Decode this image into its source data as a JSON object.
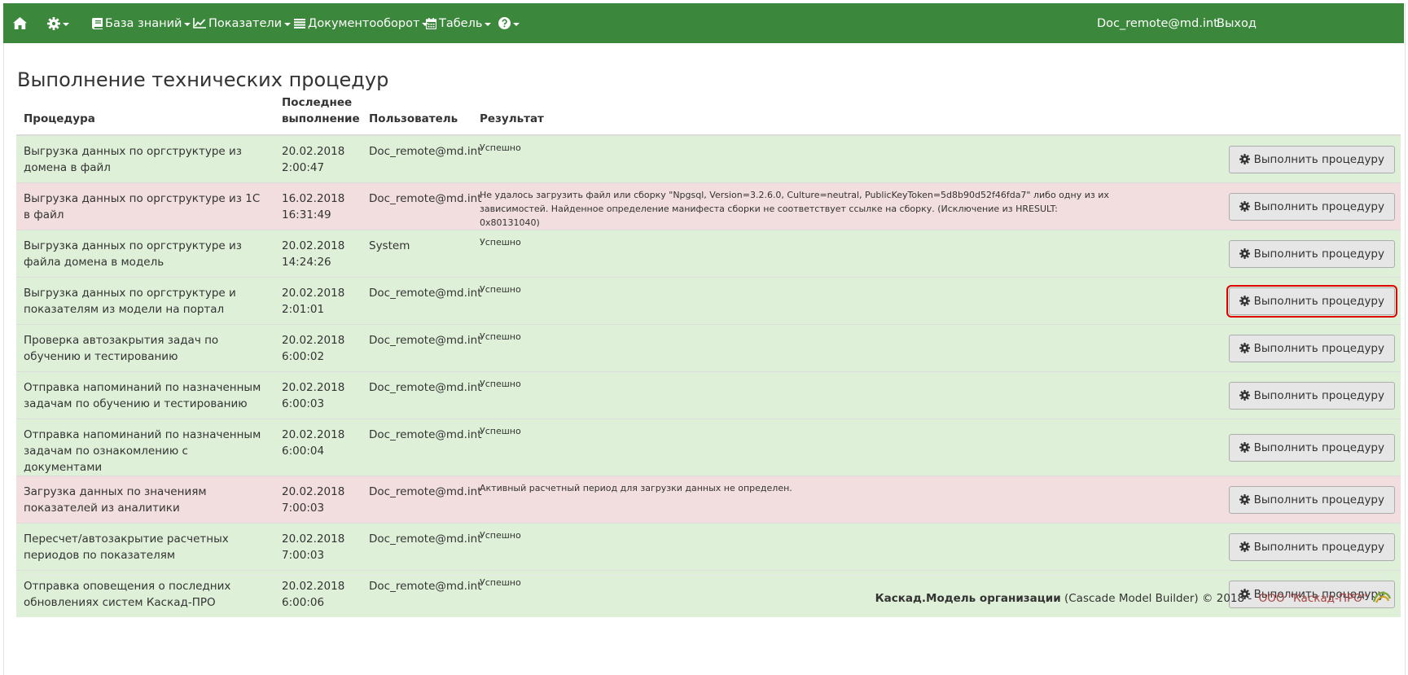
{
  "colors": {
    "navbar": "#3b873b",
    "success_row": "#dff0d8",
    "error_row": "#f2dede",
    "button_bg": "#e6e6e6",
    "highlight": "#e00000",
    "company_link": "#a94442"
  },
  "navbar": {
    "home_icon": "home-icon",
    "settings_icon": "gear-icon",
    "knowledge_base": "База знаний",
    "indicators": "Показатели",
    "document_flow": "Документооборот",
    "timesheet": "Табель",
    "help_icon": "question-circle-icon",
    "user": "Doc_remote@md.int",
    "logout": "Выход"
  },
  "page": {
    "title": "Выполнение технических процедур"
  },
  "table": {
    "headers": {
      "procedure": "Процедура",
      "last_run_line1": "Последнее",
      "last_run_line2": "выполнение",
      "user": "Пользователь",
      "result": "Результат"
    },
    "button_label": "Выполнить процедуру",
    "rows": [
      {
        "status": "success",
        "procedure": "Выгрузка данных по оргструктуре из домена в файл",
        "date": "20.02.2018",
        "time": "2:00:47",
        "user": "Doc_remote@md.int",
        "result": "Успешно"
      },
      {
        "status": "error",
        "procedure": "Выгрузка данных по оргструктуре из 1С в файл",
        "date": "16.02.2018",
        "time": "16:31:49",
        "user": "Doc_remote@md.int",
        "result": "Не удалось загрузить файл или сборку \"Npgsql, Version=3.2.6.0, Culture=neutral, PublicKeyToken=5d8b90d52f46fda7\" либо одну из их зависимостей. Найденное определение манифеста сборки не соответствует ссылке на сборку. (Исключение из HRESULT: 0x80131040)"
      },
      {
        "status": "success",
        "procedure": "Выгрузка данных по оргструктуре из файла домена в модель",
        "date": "20.02.2018",
        "time": "14:24:26",
        "user": "System",
        "result": "Успешно"
      },
      {
        "status": "success",
        "procedure": "Выгрузка данных по оргструктуре и показателям из модели на портал",
        "date": "20.02.2018",
        "time": "2:01:01",
        "user": "Doc_remote@md.int",
        "result": "Успешно"
      },
      {
        "status": "success",
        "procedure": "Проверка автозакрытия задач по обучению и тестированию",
        "date": "20.02.2018",
        "time": "6:00:02",
        "user": "Doc_remote@md.int",
        "result": "Успешно"
      },
      {
        "status": "success",
        "procedure": "Отправка напоминаний по назначенным задачам по обучению и тестированию",
        "date": "20.02.2018",
        "time": "6:00:03",
        "user": "Doc_remote@md.int",
        "result": "Успешно"
      },
      {
        "status": "success",
        "procedure": "Отправка напоминаний по назначенным задачам по ознакомлению с документами",
        "date": "20.02.2018",
        "time": "6:00:04",
        "user": "Doc_remote@md.int",
        "result": "Успешно"
      },
      {
        "status": "error",
        "procedure": "Загрузка данных по значениям показателей из аналитики",
        "date": "20.02.2018",
        "time": "7:00:03",
        "user": "Doc_remote@md.int",
        "result": "Активный расчетный период для загрузки данных не определен."
      },
      {
        "status": "success",
        "procedure": "Пересчет/автозакрытие расчетных периодов по показателям",
        "date": "20.02.2018",
        "time": "7:00:03",
        "user": "Doc_remote@md.int",
        "result": "Успешно"
      },
      {
        "status": "success",
        "procedure": "Отправка оповещения о последних обновлениях систем Каскад-ПРО",
        "date": "20.02.2018",
        "time": "6:00:06",
        "user": "Doc_remote@md.int",
        "result": "Успешно"
      }
    ]
  },
  "footer": {
    "brand": "Каскад.Модель организации",
    "rest": " (Cascade Model Builder) © 2018 - ",
    "company": "ООО \"Каскад-ПРО\"",
    "logo_icon": "kaskad-logo-icon"
  }
}
